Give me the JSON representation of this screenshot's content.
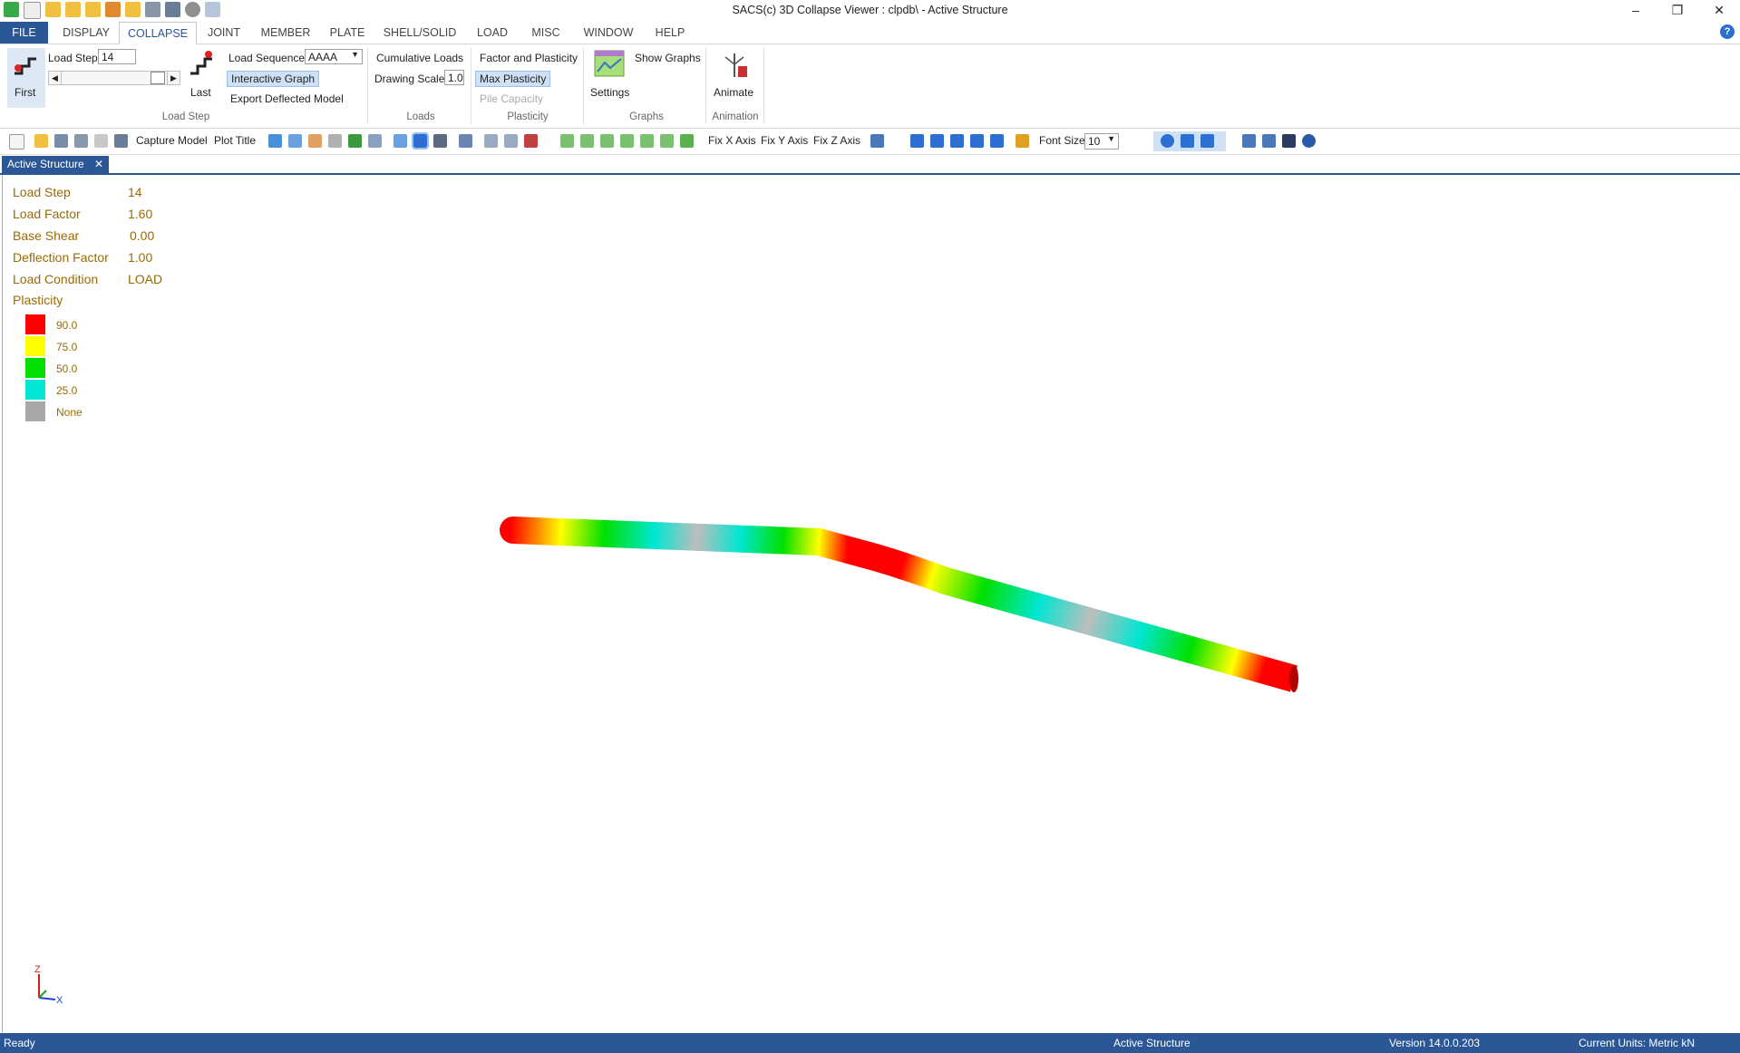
{
  "window": {
    "title": "SACS(c) 3D Collapse Viewer :  clpdb\\ - Active Structure",
    "minimize": "–",
    "restore": "❐",
    "close": "✕"
  },
  "tabs": [
    "FILE",
    "DISPLAY",
    "COLLAPSE",
    "JOINT",
    "MEMBER",
    "PLATE",
    "SHELL/SOLID",
    "LOAD",
    "MISC",
    "WINDOW",
    "HELP"
  ],
  "help": "?",
  "ribbon": {
    "first": "First",
    "last": "Last",
    "load_step_label": "Load Step",
    "load_step_value": "14",
    "load_step_group": "Load Step",
    "load_sequence_label": "Load Sequence",
    "load_sequence_value": "AAAA",
    "interactive_graph": "Interactive Graph",
    "export_deflected": "Export Deflected Model",
    "cumulative_loads": "Cumulative Loads",
    "drawing_scale_label": "Drawing Scale",
    "drawing_scale_value": "1.0",
    "loads_group": "Loads",
    "factor_plasticity": "Factor and Plasticity",
    "max_plasticity": "Max Plasticity",
    "pile_capacity": "Pile Capacity",
    "plasticity_group": "Plasticity",
    "settings": "Settings",
    "show_graphs": "Show Graphs",
    "graphs_group": "Graphs",
    "animate": "Animate",
    "animation_group": "Animation"
  },
  "toolbar": {
    "capture_model": "Capture Model",
    "plot_title": "Plot Title",
    "fix_x": "Fix X Axis",
    "fix_y": "Fix Y Axis",
    "fix_z": "Fix Z Axis",
    "font_size_label": "Font Size",
    "font_size_value": "10"
  },
  "doc_tab": {
    "label": "Active Structure",
    "close": "✕"
  },
  "info": {
    "load_step": {
      "label": "Load Step",
      "value": "14"
    },
    "load_factor": {
      "label": "Load Factor",
      "value": "1.60"
    },
    "base_shear": {
      "label": "Base Shear",
      "value": "0.00"
    },
    "deflection_factor": {
      "label": "Deflection Factor",
      "value": "1.00"
    },
    "load_condition": {
      "label": "Load Condition",
      "value": "LOAD"
    },
    "plasticity": "Plasticity"
  },
  "legend": [
    {
      "label": "90.0",
      "color": "#ff0000"
    },
    {
      "label": "75.0",
      "color": "#ffff00"
    },
    {
      "label": "50.0",
      "color": "#00e000"
    },
    {
      "label": "25.0",
      "color": "#00e6d2"
    },
    {
      "label": "None",
      "color": "#a8a8a8"
    }
  ],
  "axis": {
    "z": "Z",
    "x": "X"
  },
  "status": {
    "left": "Ready",
    "center": "Active Structure",
    "version": "Version 14.0.0.203",
    "units": "Current Units: Metric kN"
  }
}
